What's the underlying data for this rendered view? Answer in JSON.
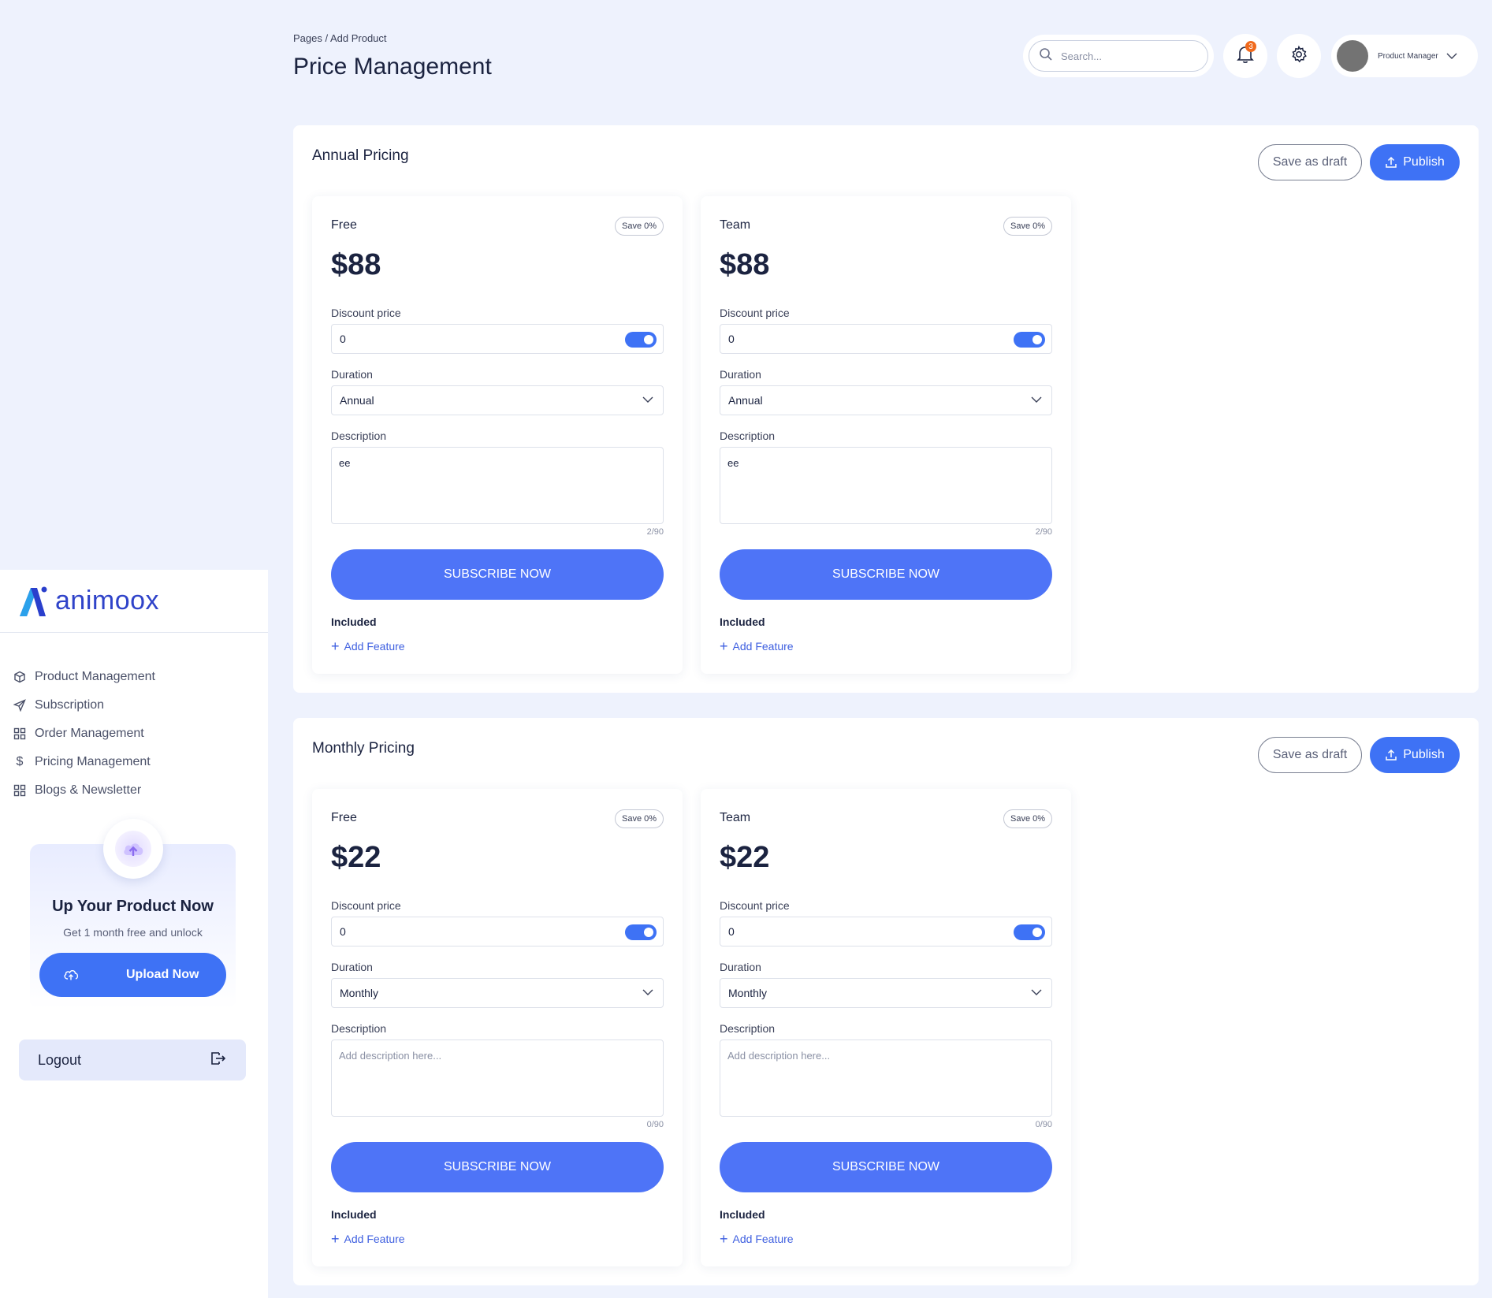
{
  "header": {
    "breadcrumb": "Pages / Add Product",
    "title": "Price Management",
    "search_placeholder": "Search...",
    "notification_count": "3",
    "profile_name": "Product Manager"
  },
  "sidebar": {
    "brand": "animoox",
    "items": [
      {
        "label": "Product Management",
        "icon": "box-icon"
      },
      {
        "label": "Subscription",
        "icon": "send-icon"
      },
      {
        "label": "Order Management",
        "icon": "grid-icon"
      },
      {
        "label": "Pricing Management",
        "icon": "dollar-icon"
      },
      {
        "label": "Blogs & Newsletter",
        "icon": "grid-icon"
      }
    ],
    "promo": {
      "title": "Up Your Product Now",
      "subtitle": "Get 1 month free and unlock",
      "button": "Upload Now"
    },
    "logout": "Logout"
  },
  "sections": [
    {
      "title": "Annual Pricing",
      "draft_label": "Save as draft",
      "publish_label": "Publish",
      "cards": [
        {
          "plan": "Free",
          "save": "Save 0%",
          "price": "$88",
          "discount_label": "Discount price",
          "discount_value": "0",
          "duration_label": "Duration",
          "duration_value": "Annual",
          "description_label": "Description",
          "description_value": "ee",
          "description_placeholder": "",
          "counter": "2/90",
          "subscribe": "SUBSCRIBE NOW",
          "included": "Included",
          "add_feature": "Add Feature"
        },
        {
          "plan": "Team",
          "save": "Save 0%",
          "price": "$88",
          "discount_label": "Discount price",
          "discount_value": "0",
          "duration_label": "Duration",
          "duration_value": "Annual",
          "description_label": "Description",
          "description_value": "ee",
          "description_placeholder": "",
          "counter": "2/90",
          "subscribe": "SUBSCRIBE NOW",
          "included": "Included",
          "add_feature": "Add Feature"
        }
      ]
    },
    {
      "title": "Monthly Pricing",
      "draft_label": "Save as draft",
      "publish_label": "Publish",
      "cards": [
        {
          "plan": "Free",
          "save": "Save 0%",
          "price": "$22",
          "discount_label": "Discount price",
          "discount_value": "0",
          "duration_label": "Duration",
          "duration_value": "Monthly",
          "description_label": "Description",
          "description_value": "",
          "description_placeholder": "Add description here...",
          "counter": "0/90",
          "subscribe": "SUBSCRIBE NOW",
          "included": "Included",
          "add_feature": "Add Feature"
        },
        {
          "plan": "Team",
          "save": "Save 0%",
          "price": "$22",
          "discount_label": "Discount price",
          "discount_value": "0",
          "duration_label": "Duration",
          "duration_value": "Monthly",
          "description_label": "Description",
          "description_value": "",
          "description_placeholder": "Add description here...",
          "counter": "0/90",
          "subscribe": "SUBSCRIBE NOW",
          "included": "Included",
          "add_feature": "Add Feature"
        }
      ]
    }
  ],
  "colors": {
    "accent": "#3e72f5",
    "background": "#eef2fd",
    "badge": "#f06a1d"
  }
}
